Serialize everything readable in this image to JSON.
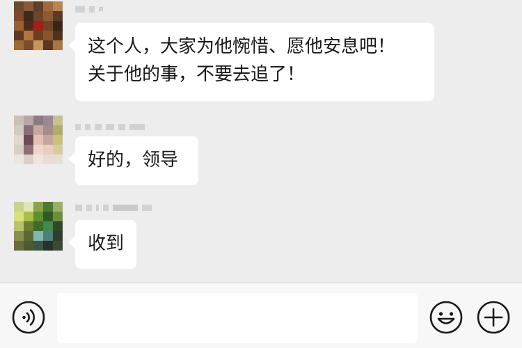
{
  "messages": [
    {
      "lines": [
        "这个人，大家为他惋惜、愿他安息吧！",
        "关于他的事，不要去追了！"
      ]
    },
    {
      "lines": [
        "好的，领导"
      ]
    },
    {
      "lines": [
        "收到"
      ]
    }
  ],
  "input_bar": {
    "voice_icon": "voice-icon",
    "emoji_icon": "emoji-icon",
    "add_icon": "add-icon"
  },
  "colors": {
    "background": "#ededed",
    "bubble": "#ffffff",
    "text": "#191919",
    "input_bar": "#f7f7f7"
  }
}
